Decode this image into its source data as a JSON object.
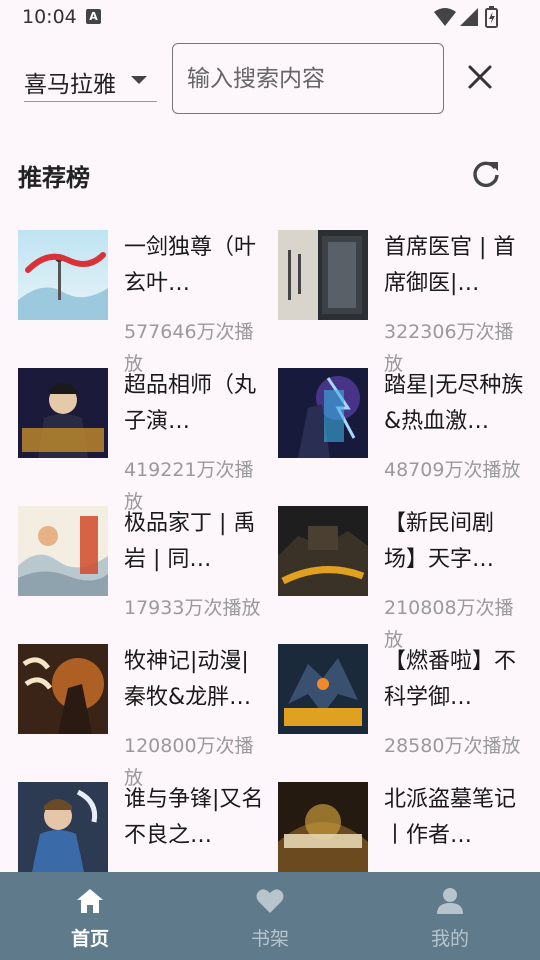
{
  "status_bar": {
    "time": "10:04",
    "notification_badge": "A"
  },
  "search": {
    "source_label": "喜马拉雅",
    "placeholder": "输入搜索内容"
  },
  "section": {
    "title": "推荐榜"
  },
  "books": [
    {
      "title": "一剑独尊（叶玄叶…",
      "plays": "577646万次播放"
    },
    {
      "title": "首席医官 | 首席御医|…",
      "plays": "322306万次播放"
    },
    {
      "title": "超品相师（丸子演…",
      "plays": "419221万次播放"
    },
    {
      "title": "踏星|无尽种族&热血激…",
      "plays": "48709万次播放"
    },
    {
      "title": "极品家丁 | 禹岩 | 同…",
      "plays": "17933万次播放"
    },
    {
      "title": "【新民间剧场】天字…",
      "plays": "210808万次播放"
    },
    {
      "title": "牧神记|动漫|秦牧&龙胖…",
      "plays": "120800万次播放"
    },
    {
      "title": "【燃番啦】不科学御…",
      "plays": "28580万次播放"
    },
    {
      "title": "谁与争锋|又名不良之…",
      "plays": ""
    },
    {
      "title": "北派盗墓笔记丨作者…",
      "plays": ""
    }
  ],
  "bottom_nav": [
    {
      "label": "首页",
      "icon": "home-icon",
      "active": true
    },
    {
      "label": "书架",
      "icon": "heart-icon",
      "active": false
    },
    {
      "label": "我的",
      "icon": "person-icon",
      "active": false
    }
  ],
  "colors": {
    "background": "#fdf6fb",
    "nav_bar": "#5f7a8a",
    "nav_active": "#ffffff",
    "nav_inactive": "#b8c4cc",
    "secondary_text": "#9a9a9a"
  }
}
